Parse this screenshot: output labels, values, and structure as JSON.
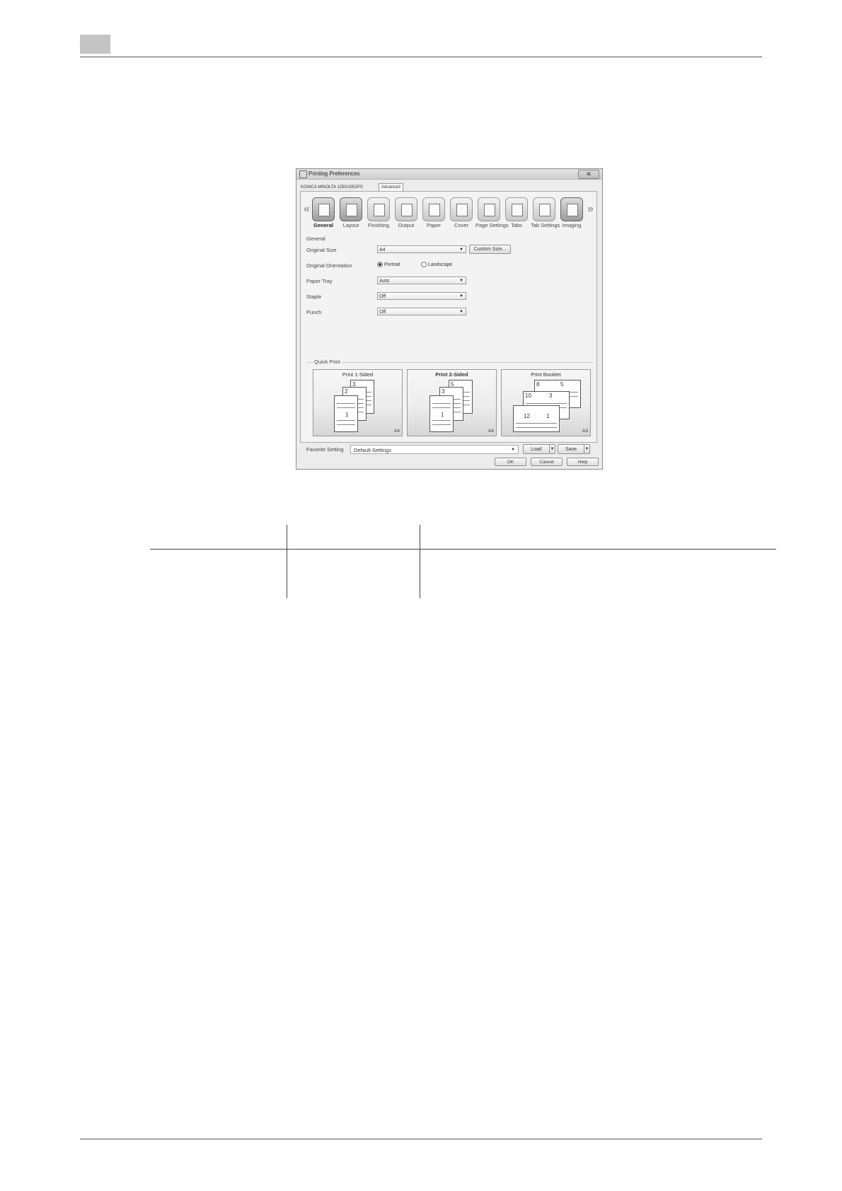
{
  "dialog": {
    "title": "Printing Preferences",
    "close_label": "✕",
    "model_name": "KONICA MINOLTA 1250/1052PS",
    "advanced_tab": "Advanced",
    "nav_left": "«",
    "nav_right": "»",
    "tabs": [
      {
        "label": "General",
        "icon": "general-icon"
      },
      {
        "label": "Layout",
        "icon": "layout-icon"
      },
      {
        "label": "Finishing",
        "icon": "finishing-icon"
      },
      {
        "label": "Output",
        "icon": "output-icon"
      },
      {
        "label": "Paper",
        "icon": "paper-icon"
      },
      {
        "label": "Cover",
        "icon": "cover-icon"
      },
      {
        "label": "Page Settings",
        "icon": "page-settings-icon"
      },
      {
        "label": "Tabs",
        "icon": "tabs-icon"
      },
      {
        "label": "Tab Settings",
        "icon": "tab-settings-icon"
      },
      {
        "label": "Imaging",
        "icon": "imaging-icon"
      }
    ],
    "active_tab": "General",
    "section_title": "General",
    "fields": {
      "original_size": {
        "label": "Original Size",
        "value": "A4",
        "custom_button": "Custom Size..."
      },
      "orientation": {
        "label": "Original Orientation",
        "option1": "Portrait",
        "option2": "Landscape",
        "selected": "Portrait"
      },
      "paper_tray": {
        "label": "Paper Tray",
        "value": "Auto"
      },
      "staple": {
        "label": "Staple",
        "value": "Off"
      },
      "punch": {
        "label": "Punch",
        "value": "Off"
      }
    },
    "quick_print": {
      "title": "Quick Print",
      "cards": [
        {
          "title": "Print 1-Sided",
          "size": "A4",
          "pages": [
            "3",
            "2",
            "1"
          ]
        },
        {
          "title": "Print 2-Sided",
          "size": "A4",
          "pages": [
            "5",
            "3",
            "1"
          ]
        },
        {
          "title": "Print Booklet",
          "size": "A3",
          "pages": [
            "8",
            "5",
            "10",
            "3",
            "12",
            "1"
          ]
        }
      ]
    },
    "favorite": {
      "label": "Favorite Setting",
      "value": "Default Settings",
      "load": "Load",
      "save": "Save"
    },
    "buttons": {
      "ok": "OK",
      "cancel": "Cancel",
      "help": "Help"
    }
  }
}
